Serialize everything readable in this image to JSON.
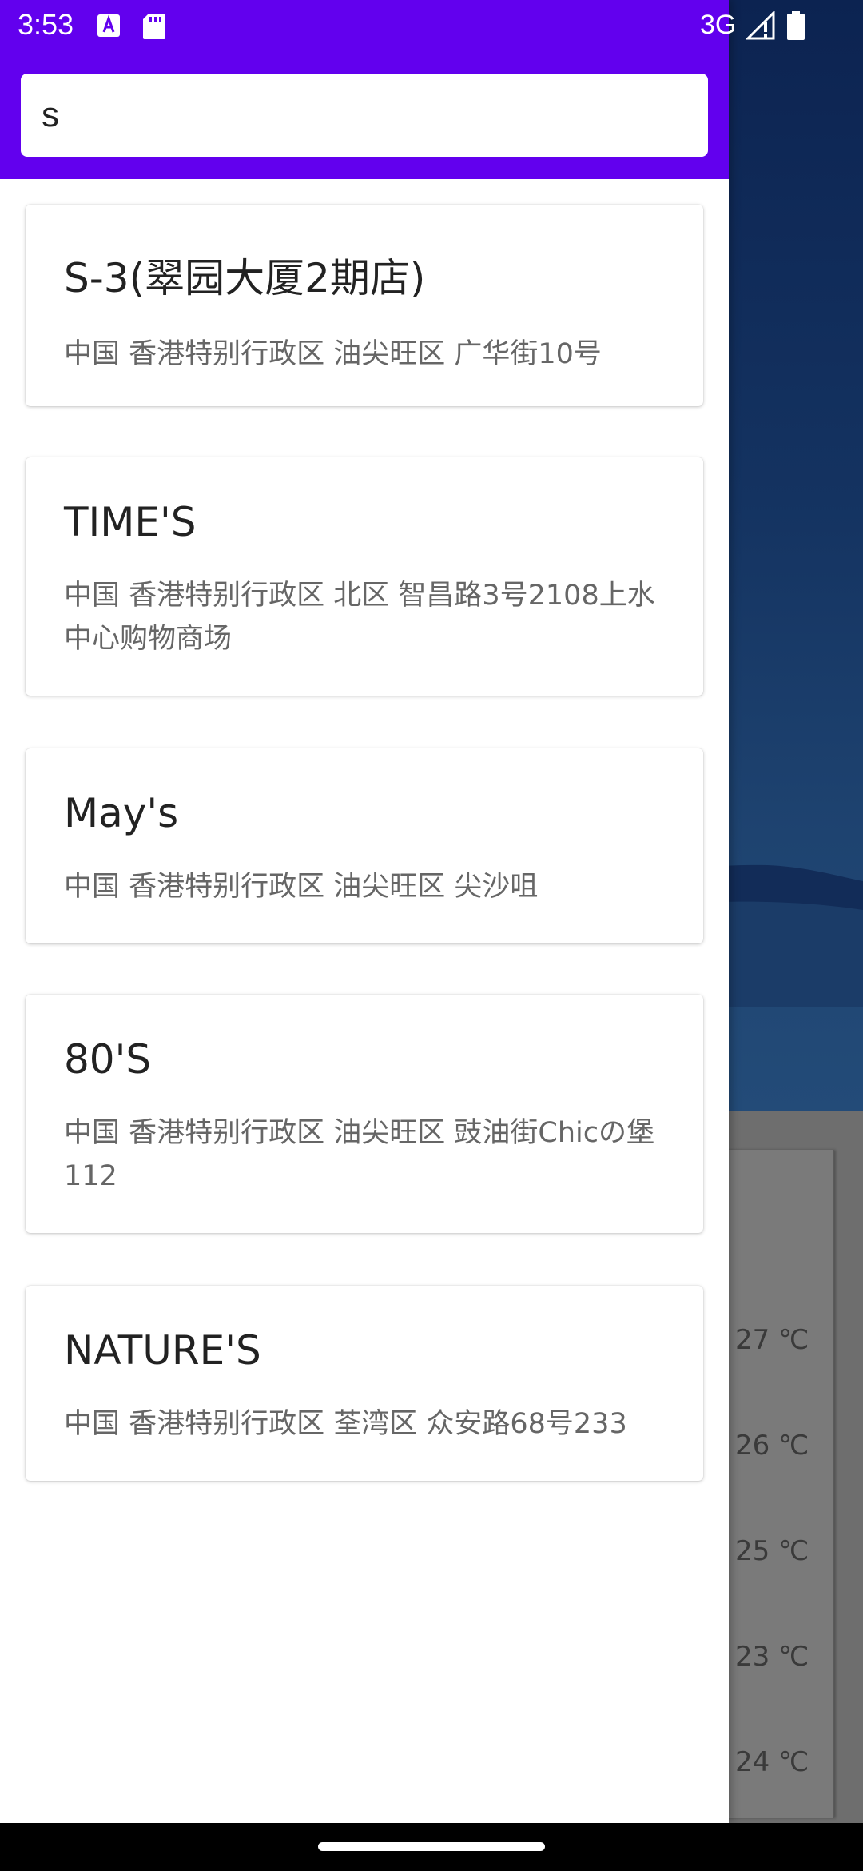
{
  "status_bar": {
    "time": "3:53",
    "network": "3G",
    "icons": [
      "font-app-icon",
      "sd-card-icon",
      "signal-icon",
      "battery-icon"
    ]
  },
  "search": {
    "value": "s",
    "placeholder": ""
  },
  "results": [
    {
      "title": "S-3(翠园大厦2期店)",
      "address": "中国 香港特别行政区 油尖旺区 广华街10号"
    },
    {
      "title": "TIME'S",
      "address": "中国 香港特别行政区 北区 智昌路3号2108上水中心购物商场"
    },
    {
      "title": "May's",
      "address": "中国 香港特别行政区 油尖旺区 尖沙咀"
    },
    {
      "title": "80'S",
      "address": "中国 香港特别行政区 油尖旺区 豉油街Chicの堡112"
    },
    {
      "title": "NATURE'S",
      "address": "中国 香港特别行政区 荃湾区 众安路68号233"
    }
  ],
  "background": {
    "temperatures": [
      "27 ℃",
      "26 ℃",
      "25 ℃",
      "23 ℃",
      "24 ℃"
    ]
  },
  "colors": {
    "accent": "#6200ee",
    "sky": "#143361",
    "scrim": "#6e6e6e"
  }
}
